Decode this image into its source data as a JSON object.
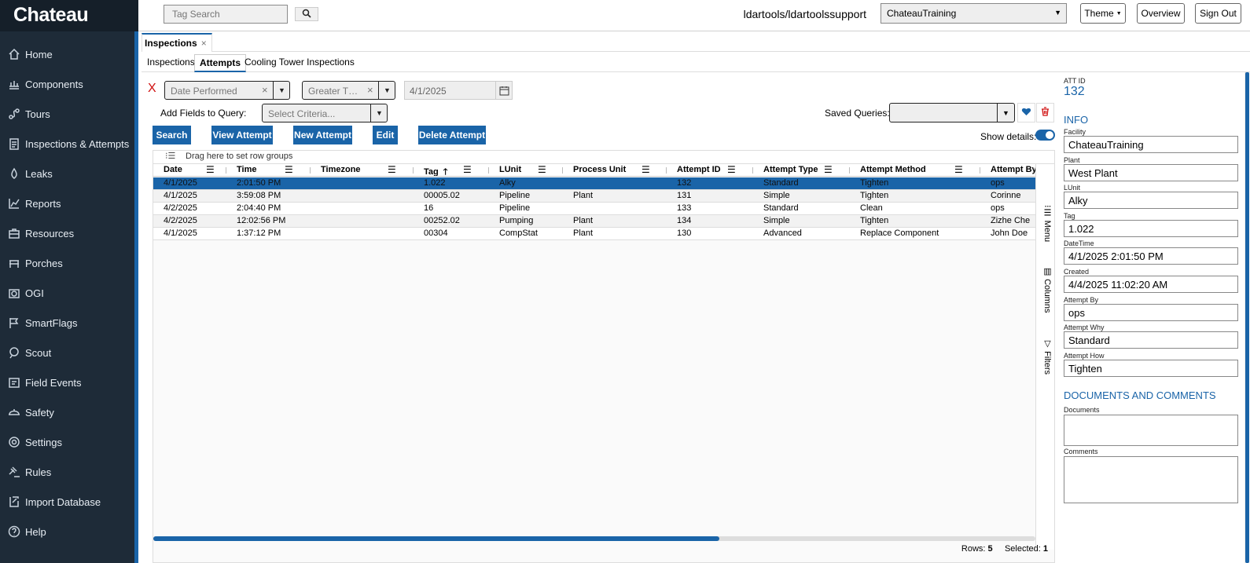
{
  "app": {
    "logo": "Chateau"
  },
  "sidebar": {
    "items": [
      {
        "label": "Home",
        "icon": "home-icon"
      },
      {
        "label": "Components",
        "icon": "components-icon"
      },
      {
        "label": "Tours",
        "icon": "tours-icon"
      },
      {
        "label": "Inspections & Attempts",
        "icon": "clipboard-icon"
      },
      {
        "label": "Leaks",
        "icon": "leak-icon"
      },
      {
        "label": "Reports",
        "icon": "chart-icon"
      },
      {
        "label": "Resources",
        "icon": "toolbox-icon"
      },
      {
        "label": "Porches",
        "icon": "porch-icon"
      },
      {
        "label": "OGI",
        "icon": "camera-icon"
      },
      {
        "label": "SmartFlags",
        "icon": "flag-icon"
      },
      {
        "label": "Scout",
        "icon": "scout-icon"
      },
      {
        "label": "Field Events",
        "icon": "field-events-icon"
      },
      {
        "label": "Safety",
        "icon": "safety-icon"
      },
      {
        "label": "Settings",
        "icon": "gear-icon"
      },
      {
        "label": "Rules",
        "icon": "gavel-icon"
      },
      {
        "label": "Import Database",
        "icon": "import-icon"
      },
      {
        "label": "Help",
        "icon": "help-icon"
      }
    ]
  },
  "header": {
    "search_placeholder": "Tag Search",
    "user": "ldartools/ldartoolssupport",
    "facility": "ChateauTraining",
    "theme_label": "Theme",
    "overview_label": "Overview",
    "signout_label": "Sign Out"
  },
  "main_tab": {
    "label": "Inspections",
    "close": "×"
  },
  "sub_tabs": {
    "inspections": "Inspections",
    "attempts": "Attempts",
    "cooling": "Cooling Tower Inspections"
  },
  "query": {
    "remove": "X",
    "field": "Date Performed",
    "operator": "Greater T…",
    "value": "4/1/2025",
    "add_fields_label": "Add Fields to Query:",
    "criteria_placeholder": "Select Criteria...",
    "saved_label": "Saved Queries:"
  },
  "actions": {
    "search": "Search",
    "view": "View Attempt",
    "new": "New Attempt",
    "edit": "Edit",
    "delete": "Delete Attempt",
    "show_details": "Show details:"
  },
  "grid": {
    "group_hint": "Drag here to set row groups",
    "columns": [
      "Date",
      "Time",
      "Timezone",
      "Tag",
      "LUnit",
      "Process Unit",
      "Attempt ID",
      "Attempt Type",
      "Attempt Method",
      "Attempt By"
    ],
    "rows": [
      [
        "4/1/2025",
        "2:01:50 PM",
        "",
        "1.022",
        "Alky",
        "",
        "132",
        "Standard",
        "Tighten",
        "ops"
      ],
      [
        "4/1/2025",
        "3:59:08 PM",
        "",
        "00005.02",
        "Pipeline",
        "Plant",
        "131",
        "Simple",
        "Tighten",
        "Corinne"
      ],
      [
        "4/2/2025",
        "2:04:40 PM",
        "",
        "16",
        "Pipeline",
        "",
        "133",
        "Standard",
        "Clean",
        "ops"
      ],
      [
        "4/2/2025",
        "12:02:56 PM",
        "",
        "00252.02",
        "Pumping",
        "Plant",
        "134",
        "Simple",
        "Tighten",
        "Zizhe Che"
      ],
      [
        "4/1/2025",
        "1:37:12 PM",
        "",
        "00304",
        "CompStat",
        "Plant",
        "130",
        "Advanced",
        "Replace Component",
        "John Doe"
      ]
    ],
    "side": {
      "menu": "Menu",
      "columns": "Columns",
      "filters": "Filters"
    },
    "rows_label": "Rows:",
    "rows_count": "5",
    "selected_label": "Selected:",
    "selected_count": "1"
  },
  "details": {
    "att_id_label": "ATT ID",
    "att_id": "132",
    "info_title": "INFO",
    "fields": [
      {
        "label": "Facility",
        "value": "ChateauTraining"
      },
      {
        "label": "Plant",
        "value": "West Plant"
      },
      {
        "label": "LUnit",
        "value": "Alky"
      },
      {
        "label": "Tag",
        "value": "1.022"
      },
      {
        "label": "DateTime",
        "value": "4/1/2025 2:01:50 PM"
      },
      {
        "label": "Created",
        "value": "4/4/2025 11:02:20 AM"
      },
      {
        "label": "Attempt By",
        "value": "ops"
      },
      {
        "label": "Attempt Why",
        "value": "Standard"
      },
      {
        "label": "Attempt How",
        "value": "Tighten"
      }
    ],
    "docs_title": "DOCUMENTS AND COMMENTS",
    "documents_label": "Documents",
    "comments_label": "Comments"
  },
  "colors": {
    "accent": "#1a64a8",
    "sidebar": "#1e2b38",
    "danger": "#d01010"
  }
}
